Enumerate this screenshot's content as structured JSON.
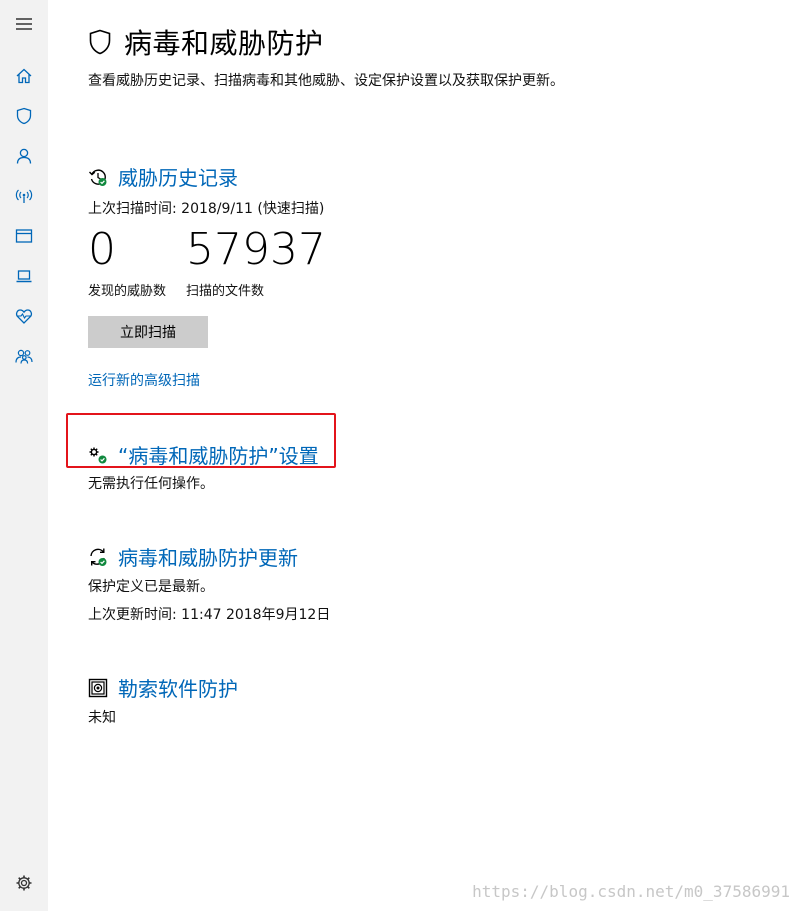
{
  "sidebar": {
    "items": [
      {
        "name": "menu-icon"
      },
      {
        "name": "home-icon"
      },
      {
        "name": "shield-icon"
      },
      {
        "name": "account-icon"
      },
      {
        "name": "network-icon"
      },
      {
        "name": "app-browser-icon"
      },
      {
        "name": "device-security-icon"
      },
      {
        "name": "health-icon"
      },
      {
        "name": "family-icon"
      },
      {
        "name": "settings-icon"
      }
    ]
  },
  "page": {
    "title": "病毒和威胁防护",
    "description": "查看威胁历史记录、扫描病毒和其他威胁、设定保护设置以及获取保护更新。"
  },
  "threat_history": {
    "title": "威胁历史记录",
    "last_scan": "上次扫描时间: 2018/9/11 (快速扫描)",
    "threats_found": "0",
    "threats_found_label": "发现的威胁数",
    "files_scanned": "57937",
    "files_scanned_label": "扫描的文件数",
    "scan_now_label": "立即扫描",
    "advanced_scan_link": "运行新的高级扫描"
  },
  "protection_settings": {
    "title": "“病毒和威胁防护”设置",
    "status": "无需执行任何操作。"
  },
  "protection_updates": {
    "title": "病毒和威胁防护更新",
    "status": "保护定义已是最新。",
    "last_update": "上次更新时间: 11:47 2018年9月12日"
  },
  "ransomware": {
    "title": "勒索软件防护",
    "status": "未知"
  },
  "watermark": "https://blog.csdn.net/m0_37586991",
  "colors": {
    "accent": "#0067b8",
    "sidebar_icon": "#0067b8",
    "ok_green": "#10893e",
    "highlight_red": "#e3141b"
  }
}
